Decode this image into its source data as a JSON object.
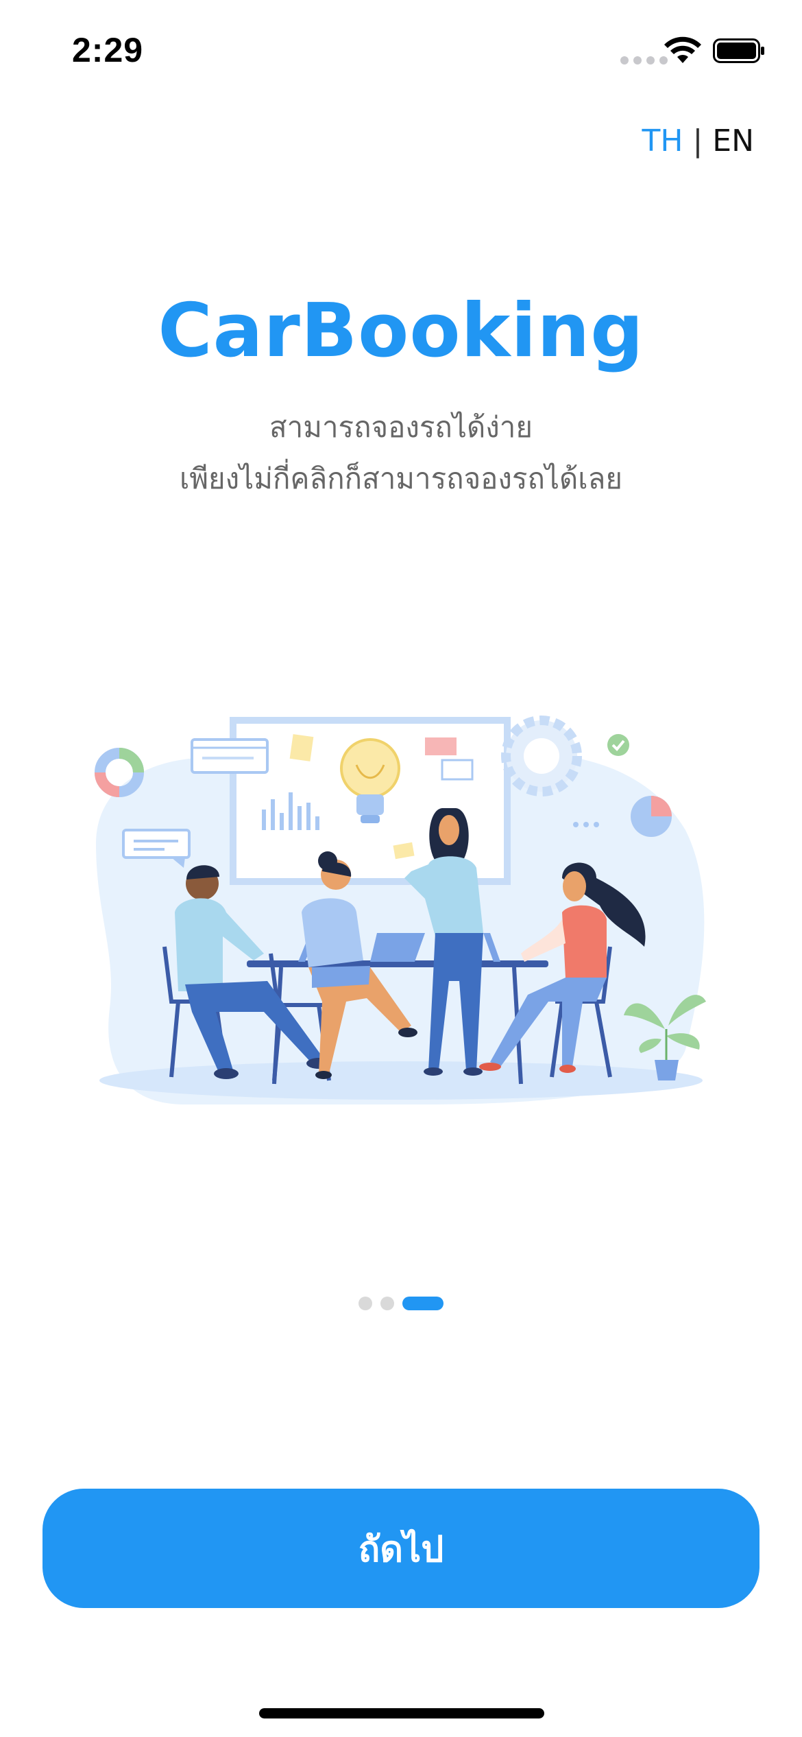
{
  "status_bar": {
    "time": "2:29"
  },
  "language": {
    "th_label": "TH",
    "separator": "|",
    "en_label": "EN",
    "active": "TH"
  },
  "onboarding": {
    "title": "CarBooking",
    "subtitle_line1": "สามารถจองรถได้ง่าย",
    "subtitle_line2": "เพียงไม่กี่คลิกก็สามารถจองรถได้เลย",
    "illustration": "team-meeting-illustration",
    "page_count": 3,
    "current_page": 3
  },
  "actions": {
    "next_label": "ถัดไป"
  },
  "colors": {
    "accent": "#2196f3",
    "text_secondary": "#666666",
    "dot_inactive": "#d9d9d9"
  }
}
